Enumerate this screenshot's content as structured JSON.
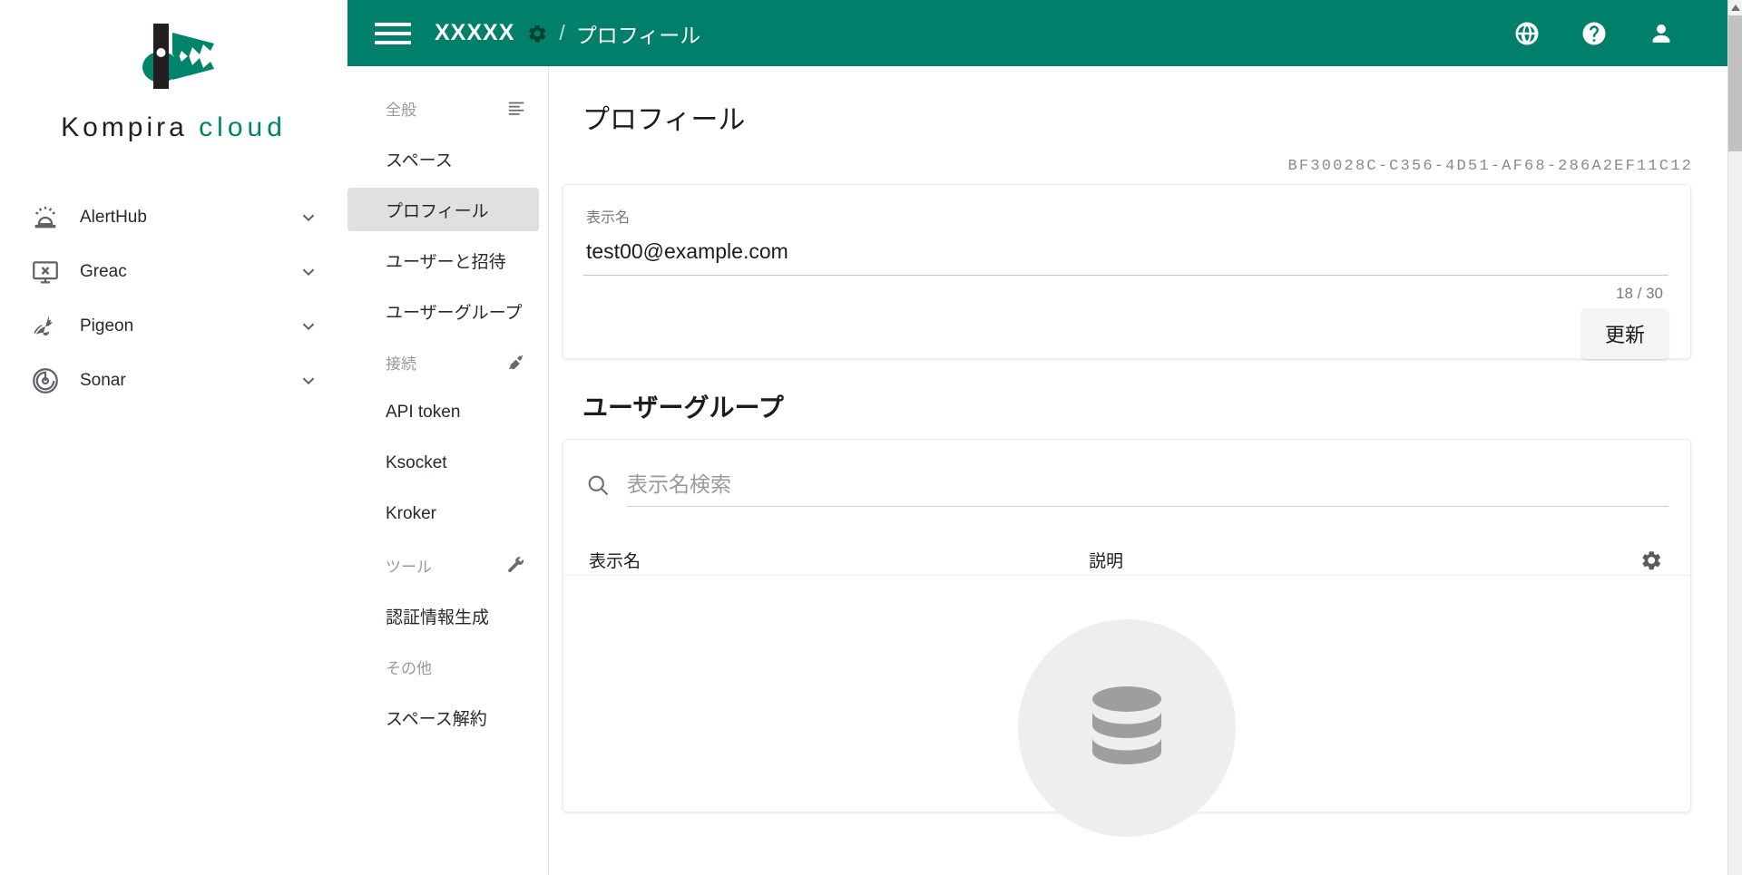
{
  "brand": {
    "name_dark": "Kompira",
    "name_accent": "cloud",
    "logo_icon": "crocodile-logo",
    "accent_color": "#00836b"
  },
  "products": [
    {
      "label": "AlertHub",
      "icon": "siren-icon",
      "chevron": "chevron-down-icon"
    },
    {
      "label": "Greac",
      "icon": "monitor-icon",
      "chevron": "chevron-down-icon"
    },
    {
      "label": "Pigeon",
      "icon": "bird-icon",
      "chevron": "chevron-down-icon"
    },
    {
      "label": "Sonar",
      "icon": "radar-icon",
      "chevron": "chevron-down-icon"
    }
  ],
  "topbar": {
    "menu_icon": "hamburger-menu-icon",
    "space_name": "XXXXX",
    "space_settings_icon": "gear-icon",
    "separator": "/",
    "current_page": "プロフィール",
    "background_color": "#00806a",
    "actions": [
      {
        "name": "language-icon",
        "glyph": "globe"
      },
      {
        "name": "help-icon",
        "glyph": "question"
      },
      {
        "name": "account-icon",
        "glyph": "person"
      }
    ]
  },
  "settings_nav": {
    "sections": [
      {
        "title": "全般",
        "icon": "list-icon",
        "items": [
          {
            "label": "スペース",
            "active": false
          },
          {
            "label": "プロフィール",
            "active": true
          },
          {
            "label": "ユーザーと招待",
            "active": false
          },
          {
            "label": "ユーザーグループ",
            "active": false
          }
        ]
      },
      {
        "title": "接続",
        "icon": "plug-icon",
        "items": [
          {
            "label": "API token",
            "active": false
          },
          {
            "label": "Ksocket",
            "active": false
          },
          {
            "label": "Kroker",
            "active": false
          }
        ]
      },
      {
        "title": "ツール",
        "icon": "wrench-icon",
        "items": [
          {
            "label": "認証情報生成",
            "active": false
          }
        ]
      },
      {
        "title": "その他",
        "icon": "",
        "items": [
          {
            "label": "スペース解約",
            "active": false
          }
        ]
      }
    ]
  },
  "main": {
    "page_title": "プロフィール",
    "uuid": "BF30028C-C356-4D51-AF68-286A2EF11C12",
    "profile_form": {
      "display_name_label": "表示名",
      "display_name_value": "test00@example.com",
      "counter": "18 / 30",
      "update_button": "更新"
    },
    "user_group": {
      "section_title": "ユーザーグループ",
      "search_icon": "search-icon",
      "search_placeholder": "表示名検索",
      "search_value": "",
      "columns": {
        "name": "表示名",
        "description": "説明",
        "settings_icon": "gear-icon"
      },
      "rows": [],
      "empty_icon": "database-icon"
    }
  },
  "scrollbar": {
    "up_arrow": "scroll-up-arrow-icon",
    "thumb": "scroll-thumb"
  }
}
